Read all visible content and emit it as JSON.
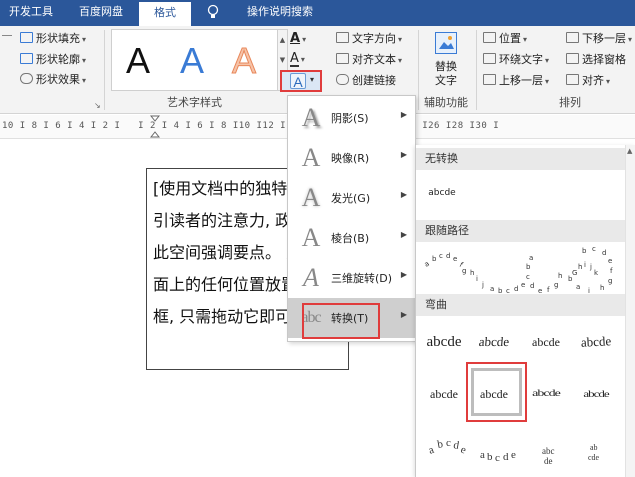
{
  "tabs": [
    "开发工具",
    "百度网盘",
    "格式",
    "操作说明搜索"
  ],
  "ribbon": {
    "shape_fill": "形状填充",
    "shape_outline": "形状轮廓",
    "shape_effects": "形状效果",
    "wordart_styles": [
      "A",
      "A",
      "A"
    ],
    "wordart_colors": [
      "#111111",
      "#3a7bd5",
      "#f0a27a"
    ],
    "wordart_group_label": "艺术字样式",
    "text_direction": "文字方向",
    "align_text": "对齐文本",
    "create_link": "创建链接",
    "replace_text_line1": "替换",
    "replace_text_line2": "文字",
    "aux_group_label": "辅助功能",
    "position": "位置",
    "wrap_text": "环绕文字",
    "bring_forward": "上移一层",
    "send_backward": "下移一层",
    "selection_pane": "选择窗格",
    "align": "对齐",
    "arrange_group_label": "排列"
  },
  "ruler": "10 I 8 I 6 I 4 I 2 I   I 2 I 4 I 6 I 8 I10 I12 I14 I16 I18 I20 I22 I24 I26 I28 I30 I",
  "document": {
    "lines": [
      "[使用文档中的独特",
      "引读者的注意力, 政",
      "此空间强调要点。 男",
      "面上的任何位置放置",
      "框, 只需拖动它即可。"
    ]
  },
  "menu": {
    "items": [
      {
        "label": "阴影(S)"
      },
      {
        "label": "映像(R)"
      },
      {
        "label": "发光(G)"
      },
      {
        "label": "棱台(B)"
      },
      {
        "label": "三维旋转(D)"
      },
      {
        "label": "转换(T)"
      }
    ],
    "transform_icon_text": "abc"
  },
  "submenu": {
    "no_transform_header": "无转换",
    "no_transform_sample": "abcde",
    "follow_path_header": "跟随路径",
    "warp_header": "弯曲",
    "warp_samples": [
      "abcde",
      "abcde",
      "abcde",
      "abcde",
      "abcde",
      "abcde",
      "abcde",
      "abcde"
    ]
  }
}
